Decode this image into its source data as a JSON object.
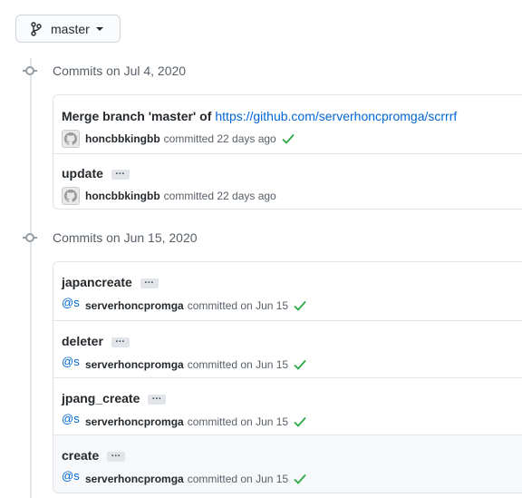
{
  "branch": {
    "name": "master"
  },
  "groups": [
    {
      "header": "Commits on Jul 4, 2020",
      "commits": [
        {
          "message": "Merge branch 'master' of",
          "link": "https://github.com/serverhoncpromga/scrrrf",
          "author": "honcbbkingbb",
          "action": "committed 22 days ago",
          "verified": true
        },
        {
          "message": "update",
          "ellipsis": "…",
          "author": "honcbbkingbb",
          "action": "committed 22 days ago",
          "verified": false
        }
      ]
    },
    {
      "header": "Commits on Jun 15, 2020",
      "commits": [
        {
          "message": "japancreate",
          "ellipsis": "…",
          "avatar_text": "@s",
          "author": "serverhoncpromga",
          "action": "committed on Jun 15",
          "verified": true
        },
        {
          "message": "deleter",
          "ellipsis": "…",
          "avatar_text": "@s",
          "author": "serverhoncpromga",
          "action": "committed on Jun 15",
          "verified": true
        },
        {
          "message": "jpang_create",
          "ellipsis": "…",
          "avatar_text": "@s",
          "author": "serverhoncpromga",
          "action": "committed on Jun 15",
          "verified": true
        },
        {
          "message": "create",
          "ellipsis": "…",
          "avatar_text": "@s",
          "author": "serverhoncpromga",
          "action": "committed on Jun 15",
          "verified": true
        }
      ]
    }
  ],
  "colors": {
    "link": "#0366d6",
    "check": "#28a745",
    "border": "#e1e4e8"
  }
}
